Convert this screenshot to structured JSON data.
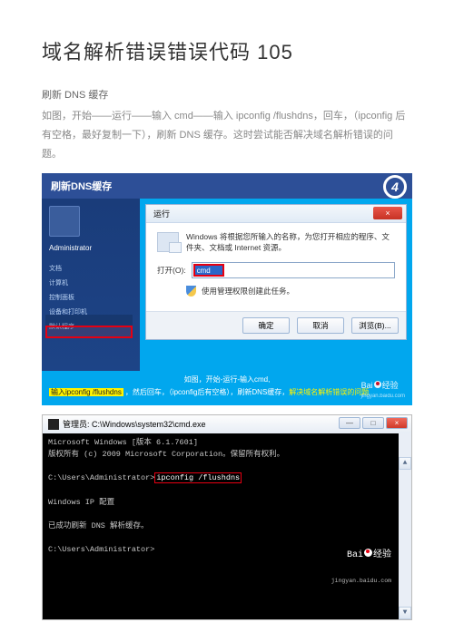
{
  "title": "域名解析错误错误代码 105",
  "meta_line": "刷新 DNS 缓存",
  "desc": "如图，开始——运行——输入 cmd——输入 ipconfig  /flushdns，回车，（ipconfig 后有空格，最好复制一下），刷新 DNS 缓存。这时尝试能否解决域名解析错误的问题。",
  "shot1": {
    "header": "刷新DNS缓存",
    "step_number": "4",
    "sidebar_user": "Administrator",
    "sidebar_items": [
      "文档",
      "计算机",
      "控制面板",
      "设备和打印机",
      "默认程序"
    ],
    "run_title": "运行",
    "run_close": "×",
    "run_body_text": "Windows 将根据您所输入的名称，为您打开相应的程序、文件夹、文档或 Internet 资源。",
    "run_open_label": "打开(O):",
    "run_input_value": "cmd",
    "run_admin_text": "使用管理权限创建此任务。",
    "buttons": {
      "ok": "确定",
      "cancel": "取消",
      "browse": "浏览(B)..."
    },
    "footer_line1": "如图，开始-运行-输入cmd,",
    "footer_cmd": "输入ipconfig /flushdns",
    "footer_rest": "，然后回车，（ipconfig后有空格），刷新DNS缓存，",
    "footer_goal": "解决域名解析错误的问题",
    "watermark_brand": "Bai",
    "watermark_brand2": "经验",
    "watermark_url": "jingyan.baidu.com"
  },
  "shot2": {
    "titlebar": "管理员: C:\\Windows\\system32\\cmd.exe",
    "min": "—",
    "max": "□",
    "close": "×",
    "line1": "Microsoft Windows [版本 6.1.7601]",
    "line2": "版权所有 (c) 2009 Microsoft Corporation。保留所有权利。",
    "prompt1_pre": "C:\\Users\\Administrator>",
    "prompt1_cmd": "ipconfig /flushdns",
    "line_cfg": "Windows IP 配置",
    "line_ok": "已成功刷新 DNS 解析缓存。",
    "prompt2": "C:\\Users\\Administrator>",
    "watermark_brand": "Bai",
    "watermark_brand2": "经验",
    "watermark_url": "jingyan.baidu.com"
  }
}
